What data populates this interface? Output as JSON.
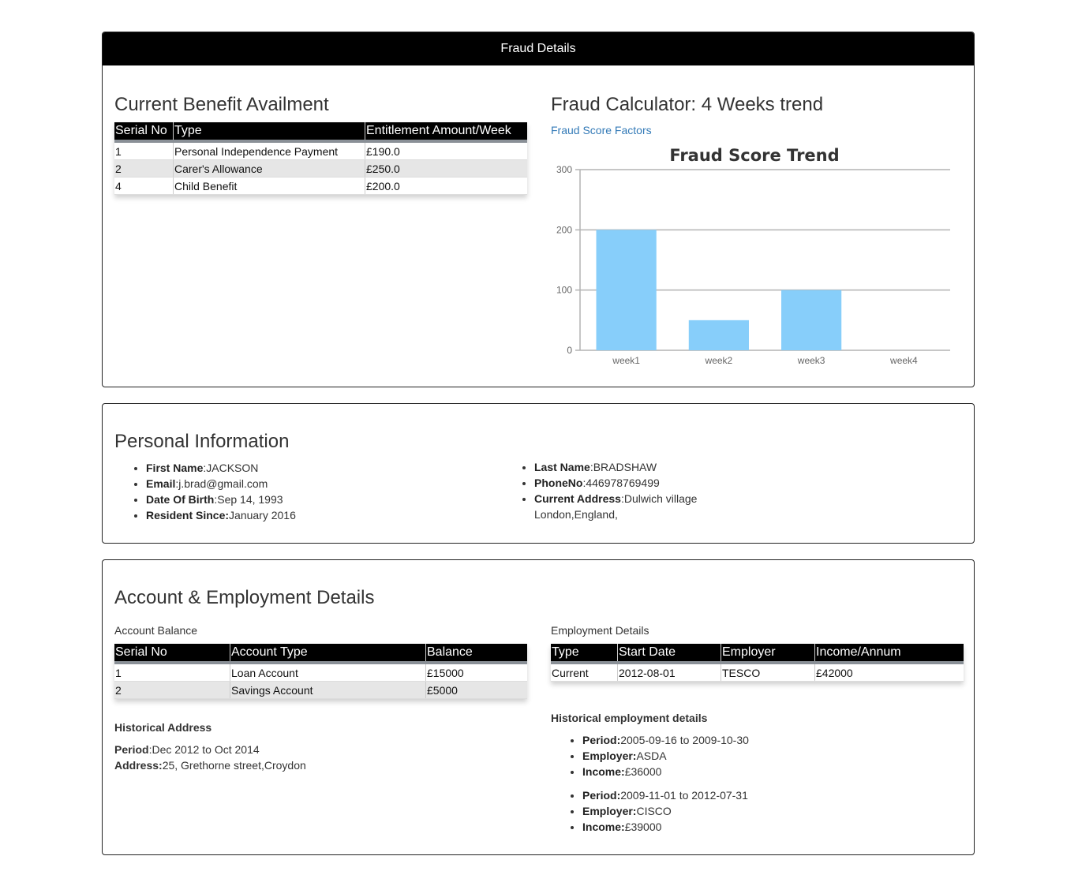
{
  "fraud": {
    "header": "Fraud Details",
    "benefit_title": "Current Benefit Availment",
    "benefit_columns": [
      "Serial No",
      "Type",
      "Entitlement Amount/Week"
    ],
    "benefit_rows": [
      [
        "1",
        "Personal Independence Payment",
        "£190.0"
      ],
      [
        "2",
        "Carer's Allowance",
        "£250.0"
      ],
      [
        "4",
        "Child Benefit",
        "£200.0"
      ]
    ],
    "calc_title": "Fraud Calculator: 4 Weeks trend",
    "factors_link": "Fraud Score Factors"
  },
  "chart_data": {
    "type": "bar",
    "title": "Fraud Score Trend",
    "categories": [
      "week1",
      "week2",
      "week3",
      "week4"
    ],
    "values": [
      200,
      50,
      100,
      0
    ],
    "ylim": [
      0,
      300
    ],
    "yticks": [
      0,
      100,
      200,
      300
    ],
    "grid": true,
    "bar_color": "#87cefa"
  },
  "personal": {
    "title": "Personal Information",
    "first_name_label": "First Name",
    "first_name": "JACKSON",
    "email_label": "Email",
    "email": "j.brad@gmail.com",
    "dob_label": "Date Of Birth",
    "dob": "Sep 14, 1993",
    "resident_label": "Resident Since:",
    "resident": "January 2016",
    "last_name_label": "Last Name",
    "last_name": "BRADSHAW",
    "phone_label": "PhoneNo",
    "phone": "446978769499",
    "address_label": "Current Address",
    "address_line1": "Dulwich village",
    "address_line2": "London,England,"
  },
  "account": {
    "title": "Account & Employment Details",
    "balance_caption": "Account Balance",
    "balance_columns": [
      "Serial No",
      "Account Type",
      "Balance"
    ],
    "balance_rows": [
      [
        "1",
        "Loan Account",
        "£15000"
      ],
      [
        "2",
        "Savings Account",
        "£5000"
      ]
    ],
    "hist_address_title": "Historical Address",
    "period_label": "Period",
    "period": "Dec 2012 to Oct 2014",
    "address_label": "Address:",
    "address": "25, Grethorne street,Croydon",
    "employment_caption": "Employment Details",
    "employment_columns": [
      "Type",
      "Start Date",
      "Employer",
      "Income/Annum"
    ],
    "employment_rows": [
      [
        "Current",
        "2012-08-01",
        "TESCO",
        "£42000"
      ]
    ],
    "hist_employment_title": "Historical employment details",
    "hist_jobs": [
      {
        "period_label": "Period:",
        "period": "2005-09-16 to 2009-10-30",
        "employer_label": "Employer:",
        "employer": "ASDA",
        "income_label": "Income:",
        "income": "£36000"
      },
      {
        "period_label": "Period:",
        "period": "2009-11-01 to 2012-07-31",
        "employer_label": "Employer:",
        "employer": "CISCO",
        "income_label": "Income:",
        "income": "£39000"
      }
    ]
  }
}
